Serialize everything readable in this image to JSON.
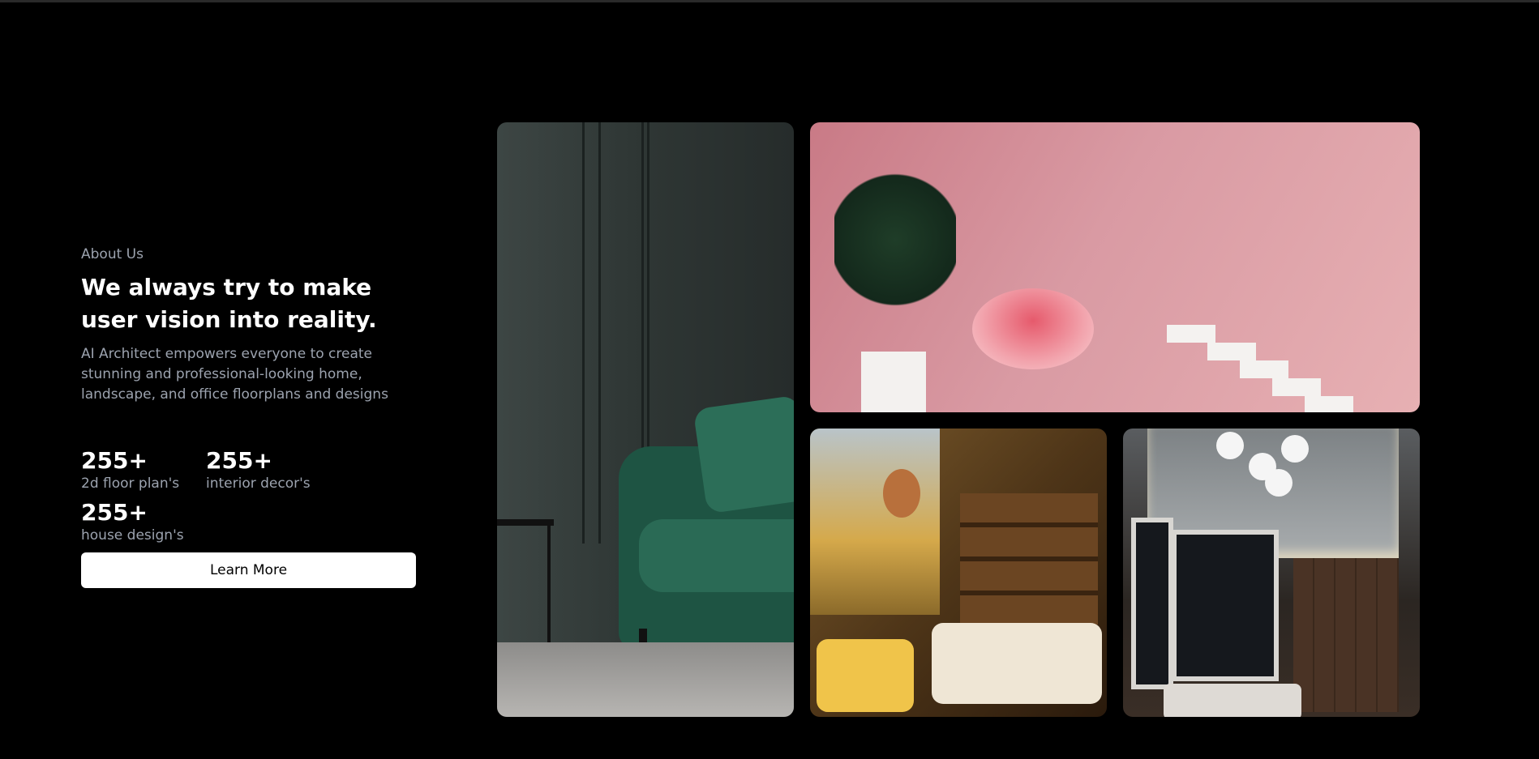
{
  "about": {
    "eyebrow": "About Us",
    "headline": "We always try to make user vision into reality.",
    "description": "AI Architect empowers everyone to create stunning and professional-looking home, landscape, and office floorplans and designs"
  },
  "stats": [
    {
      "value": "255+",
      "label": "2d floor plan's"
    },
    {
      "value": "255+",
      "label": "interior decor's"
    },
    {
      "value": "255+",
      "label": "house design's"
    }
  ],
  "cta": {
    "label": "Learn More"
  },
  "colors": {
    "background": "#000000",
    "headline": "#ffffff",
    "muted_text": "#9ca3af",
    "button_bg": "#ffffff",
    "button_text": "#000000"
  }
}
